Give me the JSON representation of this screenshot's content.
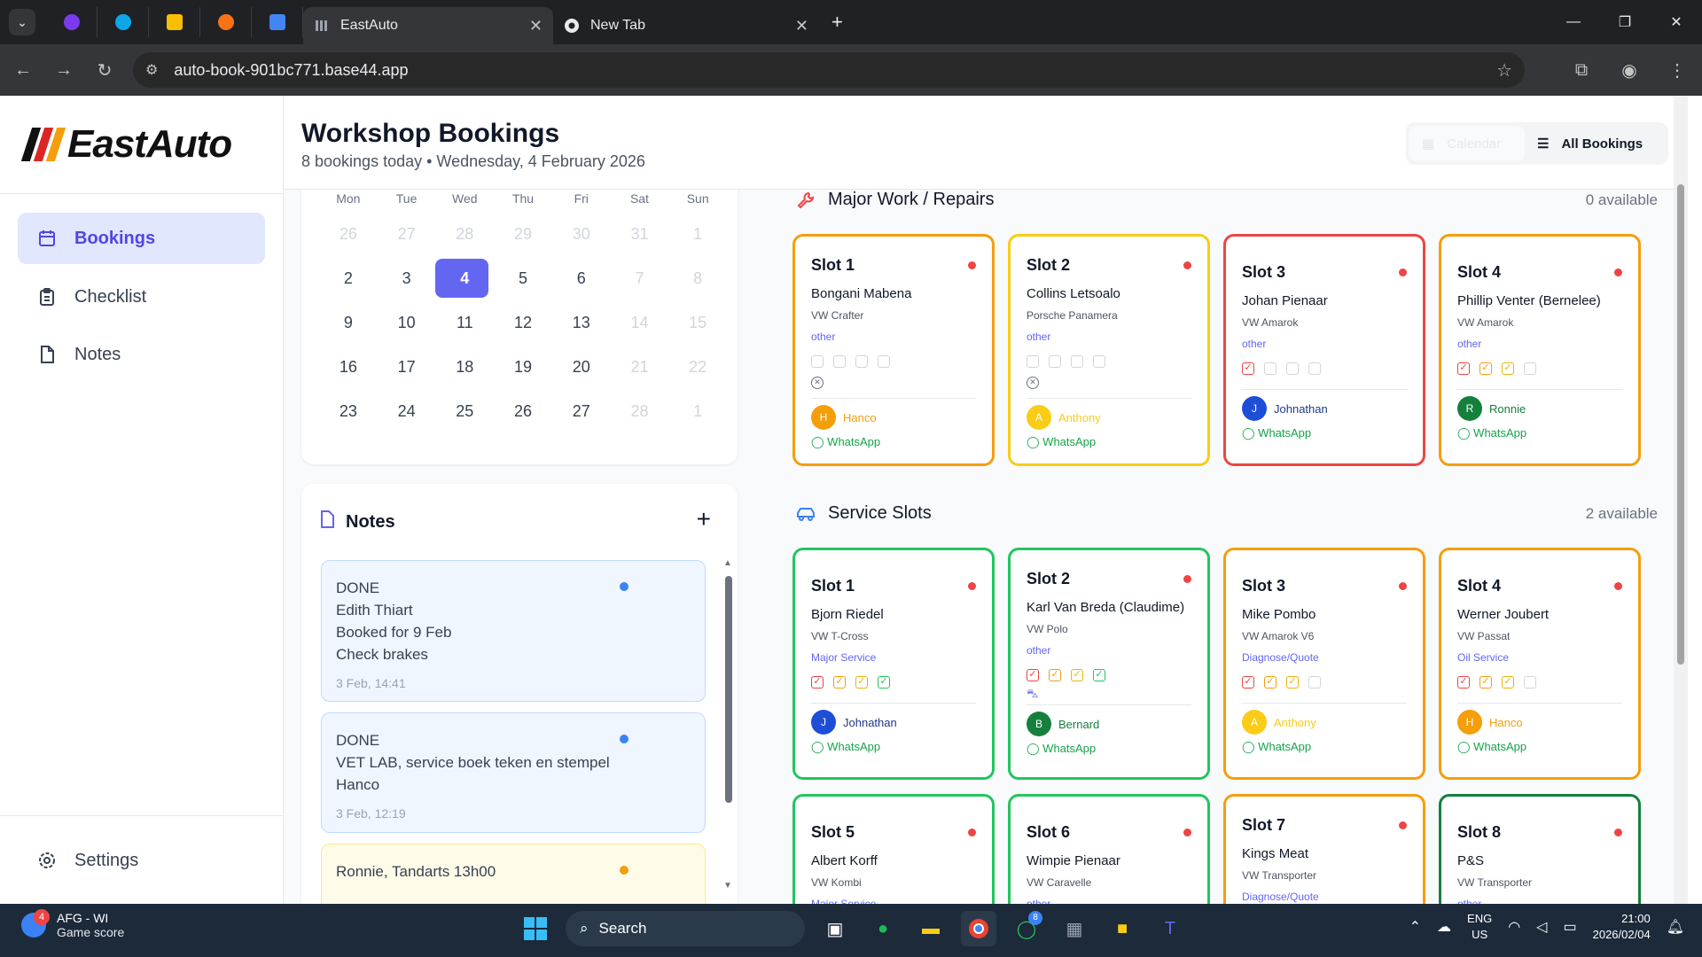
{
  "browser": {
    "tabs": [
      {
        "title": "EastAuto",
        "active": true
      },
      {
        "title": "New Tab",
        "active": false
      }
    ],
    "url": "auto-book-901bc771.base44.app"
  },
  "app": {
    "brand": "EastAuto",
    "nav": [
      {
        "label": "Bookings",
        "icon": "calendar-icon",
        "active": true
      },
      {
        "label": "Checklist",
        "icon": "clipboard-icon",
        "active": false
      },
      {
        "label": "Notes",
        "icon": "file-icon",
        "active": false
      }
    ],
    "settings_label": "Settings",
    "header": {
      "title": "Workshop Bookings",
      "subtitle": "8 bookings today • Wednesday, 4 February 2026",
      "view_calendar": "Calendar",
      "view_all": "All Bookings"
    },
    "calendar": {
      "weekdays": [
        "Mon",
        "Tue",
        "Wed",
        "Thu",
        "Fri",
        "Sat",
        "Sun"
      ],
      "weeks": [
        [
          "26",
          "27",
          "28",
          "29",
          "30",
          "31",
          "1"
        ],
        [
          "2",
          "3",
          "4",
          "5",
          "6",
          "7",
          "8"
        ],
        [
          "9",
          "10",
          "11",
          "12",
          "13",
          "14",
          "15"
        ],
        [
          "16",
          "17",
          "18",
          "19",
          "20",
          "21",
          "22"
        ],
        [
          "23",
          "24",
          "25",
          "26",
          "27",
          "28",
          "1"
        ]
      ],
      "selected": "4"
    },
    "notes": {
      "title": "Notes",
      "items": [
        {
          "lines": [
            "DONE",
            "Edith Thiart",
            "Booked for 9 Feb",
            "Check brakes"
          ],
          "time": "3 Feb, 14:41",
          "color": "blue"
        },
        {
          "lines": [
            "DONE",
            "VET LAB, service boek teken en stempel",
            "Hanco"
          ],
          "time": "3 Feb, 12:19",
          "color": "blue"
        },
        {
          "lines": [
            "Ronnie, Tandarts 13h00"
          ],
          "time": "",
          "color": "yellow"
        }
      ]
    },
    "major": {
      "title": "Major Work / Repairs",
      "available": "0 available",
      "slots": [
        {
          "title": "Slot 1",
          "name": "Bongani Mabena",
          "car": "VW Crafter",
          "type": "other",
          "staff": "Hanco",
          "initial": "H",
          "whatsapp": "WhatsApp"
        },
        {
          "title": "Slot 2",
          "name": "Collins Letsoalo",
          "car": "Porsche Panamera",
          "type": "other",
          "staff": "Anthony",
          "initial": "A",
          "whatsapp": "WhatsApp"
        },
        {
          "title": "Slot 3",
          "name": "Johan Pienaar",
          "car": "VW Amarok",
          "type": "other",
          "staff": "Johnathan",
          "initial": "J",
          "whatsapp": "WhatsApp"
        },
        {
          "title": "Slot 4",
          "name": "Phillip Venter (Bernelee)",
          "car": "VW Amarok",
          "type": "other",
          "staff": "Ronnie",
          "initial": "R",
          "whatsapp": "WhatsApp"
        }
      ]
    },
    "service": {
      "title": "Service Slots",
      "available": "2 available",
      "slots": [
        {
          "title": "Slot 1",
          "name": "Bjorn Riedel",
          "car": "VW T-Cross",
          "type": "Major Service",
          "staff": "Johnathan",
          "initial": "J",
          "whatsapp": "WhatsApp"
        },
        {
          "title": "Slot 2",
          "name": "Karl Van Breda (Claudime)",
          "car": "VW Polo",
          "type": "other",
          "staff": "Bernard",
          "initial": "B",
          "whatsapp": "WhatsApp"
        },
        {
          "title": "Slot 3",
          "name": "Mike Pombo",
          "car": "VW Amarok V6",
          "type": "Diagnose/Quote",
          "staff": "Anthony",
          "initial": "A",
          "whatsapp": "WhatsApp"
        },
        {
          "title": "Slot 4",
          "name": "Werner Joubert",
          "car": "VW Passat",
          "type": "Oil Service",
          "staff": "Hanco",
          "initial": "H",
          "whatsapp": "WhatsApp"
        },
        {
          "title": "Slot 5",
          "name": "Albert Korff",
          "car": "VW Kombi",
          "type": "Major Service"
        },
        {
          "title": "Slot 6",
          "name": "Wimpie Pienaar",
          "car": "VW Caravelle",
          "type": "other"
        },
        {
          "title": "Slot 7",
          "name": "Kings Meat",
          "car": "VW Transporter",
          "type": "Diagnose/Quote"
        },
        {
          "title": "Slot 8",
          "name": "P&S",
          "car": "VW Transporter",
          "type": "other"
        }
      ]
    }
  },
  "taskbar": {
    "weather_title": "AFG - WI",
    "weather_sub": "Game score",
    "weather_badge": "4",
    "search": "Search",
    "whatsapp_badge": "8",
    "lang1": "ENG",
    "lang2": "US",
    "time": "21:00",
    "date": "2026/02/04"
  },
  "colors": {
    "accent": "#6366f1",
    "orange": "#f59e0b",
    "yellow": "#facc15",
    "red": "#ef4444",
    "green": "#22c55e",
    "darkgreen": "#15803d"
  }
}
